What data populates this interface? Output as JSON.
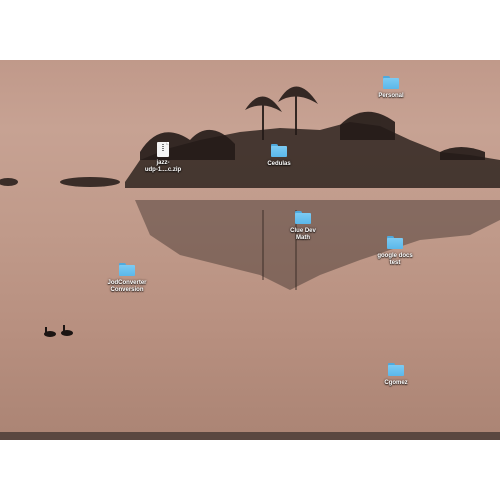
{
  "desktop": {
    "wallpaper": {
      "sky_color": "#c0998a",
      "water_color": "#b89080",
      "island_color": "#2f2420"
    },
    "icons": [
      {
        "label": "Personal",
        "icon": "folder-icon"
      },
      {
        "label": "jazz-\nudp-1....c.zip",
        "icon": "zip-file-icon"
      },
      {
        "label": "Cedulas",
        "icon": "folder-icon"
      },
      {
        "label": "Clue Dev\nMath",
        "icon": "folder-icon"
      },
      {
        "label": "google docs\ntest",
        "icon": "folder-icon"
      },
      {
        "label": "JodConverter\nConversion",
        "icon": "folder-icon"
      },
      {
        "label": "Cgomez",
        "icon": "folder-icon"
      }
    ]
  },
  "colors": {
    "folder": "#5ab7ea",
    "label_text": "#ffffff",
    "taskbar": "#5a4740"
  }
}
